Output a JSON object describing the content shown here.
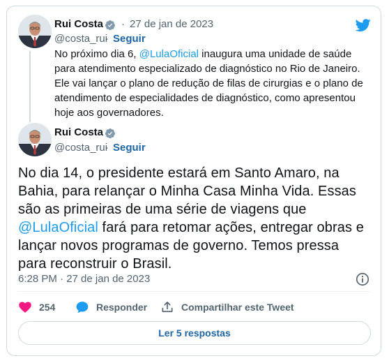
{
  "quoted_tweet": {
    "author_name": "Rui Costa",
    "handle": "@costa_rui",
    "date": "27 de jan de 2023",
    "follow_label": "Seguir",
    "text_before_mention": "No próximo dia 6, ",
    "mention": "@LulaOficial",
    "text_after_mention": " inaugura uma unidade de saúde para atendimento especializado de diagnóstico no Rio de Janeiro. Ele vai lançar o plano de redução de filas de cirurgias e o plano de atendimento de especialidades de diagnóstico, como apresentou hoje aos governadores."
  },
  "main_tweet": {
    "author_name": "Rui Costa",
    "handle": "@costa_rui",
    "follow_label": "Seguir",
    "text_before_mention": "No dia 14, o presidente estará em Santo Amaro, na Bahia, para relançar o Minha Casa Minha Vida. Essas são as primeiras de uma série de viagens que ",
    "mention": "@LulaOficial",
    "text_after_mention": " fará para retomar ações, entregar obras e lançar novos programas de governo. Temos pressa para reconstruir o Brasil.",
    "timestamp": "6:28 PM · 27 de jan de 2023"
  },
  "actions": {
    "likes_count": "254",
    "reply_label": "Responder",
    "share_label": "Compartilhar este Tweet"
  },
  "replies_button_label": "Ler 5 respostas",
  "colors": {
    "brand_blue": "#1d9bf0",
    "like_pink": "#f91880",
    "link_blue": "#1d65a6"
  },
  "icons": [
    "twitter-bird-icon",
    "verified-badge-icon",
    "info-icon",
    "heart-icon",
    "reply-bubble-icon",
    "share-icon"
  ]
}
